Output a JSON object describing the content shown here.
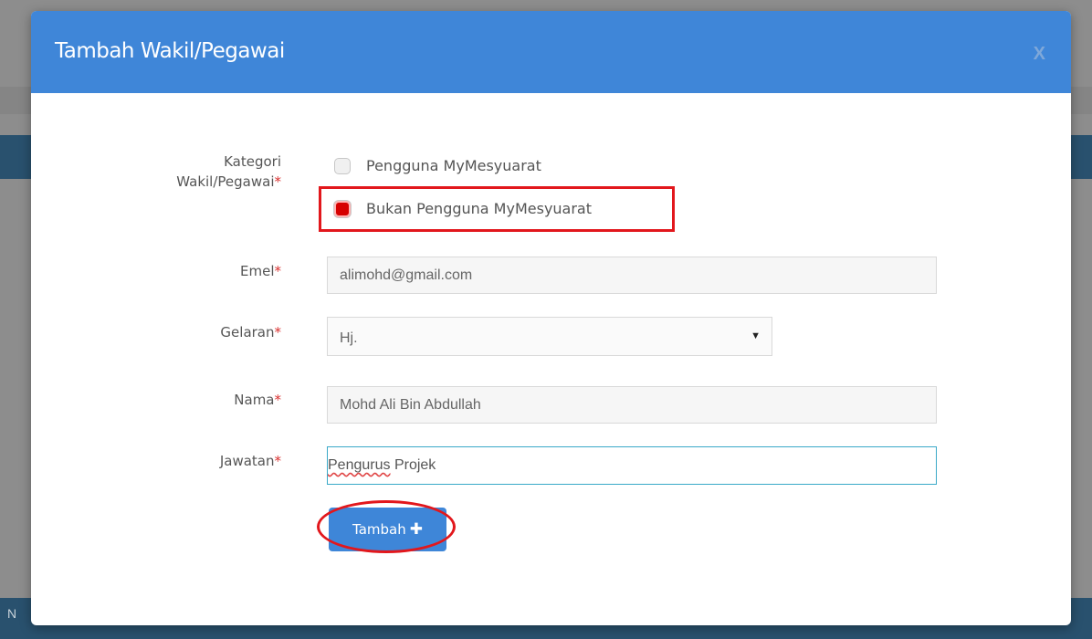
{
  "modal": {
    "title": "Tambah Wakil/Pegawai",
    "close_label": "X"
  },
  "form": {
    "category": {
      "label_line1": "Kategori",
      "label_line2": "Wakil/Pegawai",
      "required_mark": "*",
      "options": [
        {
          "label": "Pengguna MyMesyuarat",
          "checked": false
        },
        {
          "label": "Bukan Pengguna MyMesyuarat",
          "checked": true
        }
      ]
    },
    "email": {
      "label": "Emel",
      "required_mark": "*",
      "value": "alimohd@gmail.com"
    },
    "title_field": {
      "label": "Gelaran",
      "required_mark": "*",
      "value": "Hj.",
      "arrow": "▼"
    },
    "name": {
      "label": "Nama",
      "required_mark": "*",
      "value": "Mohd Ali Bin Abdullah"
    },
    "position": {
      "label": "Jawatan",
      "required_mark": "*",
      "value_word1": "Pengurus",
      "value_word2": " Projek"
    },
    "submit": {
      "label": "Tambah",
      "icon": "plus-icon"
    }
  },
  "background": {
    "edge_letter": "N"
  },
  "colors": {
    "header": "#3f86d8",
    "highlight": "#e2171c",
    "required": "#d9302f"
  }
}
